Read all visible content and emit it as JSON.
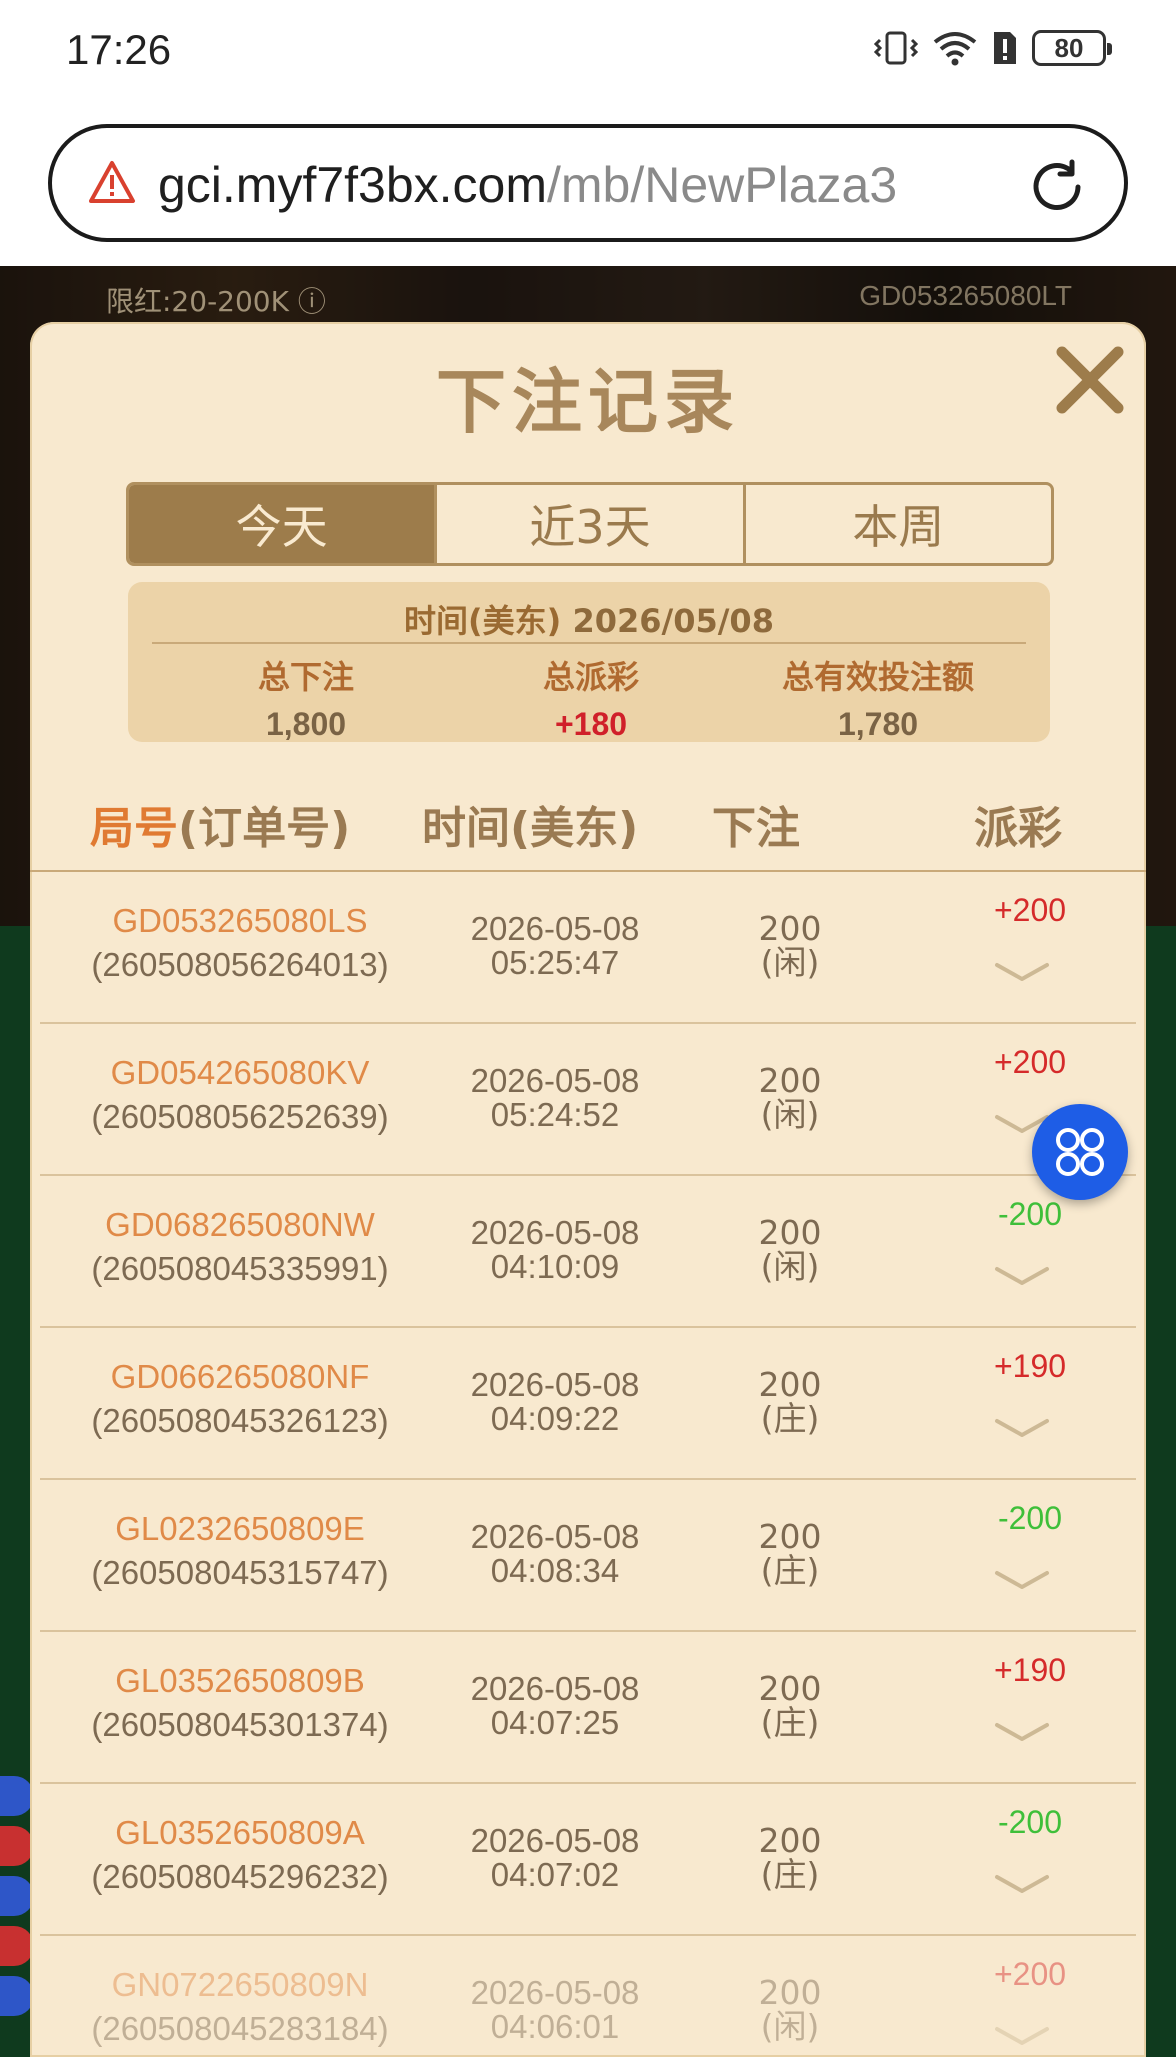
{
  "status_bar": {
    "time": "17:26",
    "battery": "80"
  },
  "browser": {
    "url_host": "gci.myf7f3bx.com",
    "url_path": "/mb/NewPlaza3"
  },
  "game": {
    "limit": "限红:20-200K ⓘ",
    "table_id": "GD053265080LT"
  },
  "modal": {
    "title": "下注记录",
    "tabs": [
      {
        "label": "今天",
        "active": true
      },
      {
        "label": "近3天",
        "active": false
      },
      {
        "label": "本周",
        "active": false
      }
    ],
    "summary": {
      "date_label": "时间(美东)",
      "date_value": "2026/05/08",
      "total_bet_label": "总下注",
      "total_bet_value": "1,800",
      "total_payout_label": "总派彩",
      "total_payout_value": "+180",
      "total_valid_label": "总有效投注额",
      "total_valid_value": "1,780"
    },
    "headers": {
      "round_a": "局号",
      "round_b": "(订单号)",
      "time": "时间(美东)",
      "bet": "下注",
      "payout": "派彩"
    },
    "rows": [
      {
        "round": "GD053265080LS",
        "order": "(260508056264013)",
        "date": "2026-05-08",
        "time": "05:25:47",
        "amount": "200",
        "side": "(闲)",
        "payout": "+200"
      },
      {
        "round": "GD054265080KV",
        "order": "(260508056252639)",
        "date": "2026-05-08",
        "time": "05:24:52",
        "amount": "200",
        "side": "(闲)",
        "payout": "+200"
      },
      {
        "round": "GD068265080NW",
        "order": "(260508045335991)",
        "date": "2026-05-08",
        "time": "04:10:09",
        "amount": "200",
        "side": "(闲)",
        "payout": "-200"
      },
      {
        "round": "GD066265080NF",
        "order": "(260508045326123)",
        "date": "2026-05-08",
        "time": "04:09:22",
        "amount": "200",
        "side": "(庄)",
        "payout": "+190"
      },
      {
        "round": "GL0232650809E",
        "order": "(260508045315747)",
        "date": "2026-05-08",
        "time": "04:08:34",
        "amount": "200",
        "side": "(庄)",
        "payout": "-200"
      },
      {
        "round": "GL0352650809B",
        "order": "(260508045301374)",
        "date": "2026-05-08",
        "time": "04:07:25",
        "amount": "200",
        "side": "(庄)",
        "payout": "+190"
      },
      {
        "round": "GL0352650809A",
        "order": "(260508045296232)",
        "date": "2026-05-08",
        "time": "04:07:02",
        "amount": "200",
        "side": "(庄)",
        "payout": "-200"
      },
      {
        "round": "GN0722650809N",
        "order": "(260508045283184)",
        "date": "2026-05-08",
        "time": "04:06:01",
        "amount": "200",
        "side": "(闲)",
        "payout": "+200"
      }
    ]
  },
  "colors": {
    "positive": "#d52a2a",
    "negative": "#3fbf3a",
    "accent": "#9d7c4b",
    "float_button": "#1e5de6"
  },
  "icons": {
    "warning": "warning-icon",
    "reload": "reload-icon",
    "close": "close-icon",
    "chevron": "chevron-down-icon",
    "apps": "apps-grid-icon"
  }
}
